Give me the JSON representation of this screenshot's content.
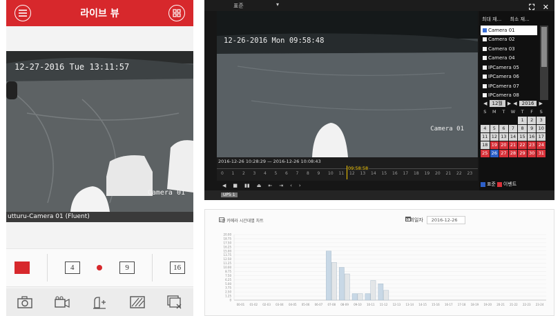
{
  "mobile_app": {
    "header": {
      "title": "라이브 뷰"
    },
    "video": {
      "timestamp": "12-27-2016 Tue 13:11:57",
      "camera_label": "Camera 01",
      "name_bar": "utturu-Camera 01 (Fluent)"
    },
    "layout_options": [
      "1",
      "4",
      "",
      "9",
      "16"
    ],
    "toolbar_icons": [
      "camera-icon",
      "video-record-icon",
      "ptz-icon",
      "image-quality-icon",
      "close-view-icon"
    ]
  },
  "nvr_playback": {
    "top_bar": {
      "standard_label": "표준",
      "arrow": "▾"
    },
    "window_controls": [
      "⛶",
      "✕"
    ],
    "video": {
      "timestamp": "12-26-2016 Mon 09:58:48",
      "camera_label": "Camera 01"
    },
    "tabs": [
      "최대 재...",
      "최소 재..."
    ],
    "cameras": [
      {
        "label": "Camera 01",
        "selected": true
      },
      {
        "label": "Camera 02",
        "selected": false
      },
      {
        "label": "Camera 03",
        "selected": false
      },
      {
        "label": "Camera 04",
        "selected": false
      },
      {
        "label": "IPCamera 05",
        "selected": false
      },
      {
        "label": "IPCamera 06",
        "selected": false
      },
      {
        "label": "IPCamera 07",
        "selected": false
      },
      {
        "label": "IPCamera 08",
        "selected": false
      }
    ],
    "calendar": {
      "month_label": "12월",
      "year_label": "2016",
      "weekdays": [
        "S",
        "M",
        "T",
        "W",
        "T",
        "F",
        "S"
      ],
      "start_offset": 4,
      "days": 31,
      "recorded_days": [
        19,
        20,
        21,
        22,
        23,
        24,
        25,
        26,
        27,
        28,
        29,
        30,
        31
      ],
      "today": 26
    },
    "timeline": {
      "range_text": "2016-12-26 10:28:29 — 2016-12-26 10:08:43",
      "current_marker": "09:58:58",
      "tick_labels": [
        "0",
        "1",
        "2",
        "3",
        "4",
        "5",
        "6",
        "7",
        "8",
        "9",
        "10",
        "11",
        "12",
        "13",
        "14",
        "15",
        "16",
        "17",
        "18",
        "19",
        "20",
        "21",
        "22",
        "23"
      ]
    },
    "controls": [
      "◀",
      "■",
      "▮▮",
      "⏏",
      "⇤",
      "⇥",
      "‹",
      "›"
    ],
    "legend": [
      {
        "label": "표준",
        "color": "#2d5fc7"
      },
      {
        "label": "이벤트",
        "color": "#d8323a"
      }
    ],
    "bottom_tag": "UP5 1"
  },
  "recording_chart": {
    "title": "1번 카메라 시간대별 차트",
    "date_label": "조회일자",
    "date_value": "2016-12-26",
    "chart_data": {
      "type": "bar",
      "categories": [
        "00-01",
        "01-02",
        "02-03",
        "03-04",
        "04-05",
        "05-06",
        "06-07",
        "07-08",
        "08-09",
        "09-10",
        "10-11",
        "11-12",
        "12-13",
        "13-14",
        "14-15",
        "15-16",
        "16-17",
        "17-18",
        "18-19",
        "19-20",
        "20-21",
        "21-22",
        "22-23",
        "23-24"
      ],
      "series": [
        {
          "values": [
            0,
            0,
            0,
            0,
            0,
            0,
            0,
            15.0,
            10.0,
            2.0,
            2.0,
            5.0,
            0,
            0,
            0,
            0,
            0,
            0,
            0,
            0,
            0,
            0,
            0,
            0
          ]
        },
        {
          "values": [
            0,
            0,
            0,
            0,
            0,
            0,
            0,
            11.5,
            8.0,
            2.0,
            6.0,
            3.0,
            0,
            0,
            0,
            0,
            0,
            0,
            0,
            0,
            0,
            0,
            0,
            0
          ]
        }
      ],
      "ylim": [
        0,
        20
      ],
      "y_ticks": [
        "20.00",
        "18.75",
        "17.50",
        "16.25",
        "15.00",
        "13.75",
        "12.50",
        "11.25",
        "10.00",
        "8.75",
        "7.50",
        "6.25",
        "5.00",
        "3.75",
        "2.50",
        "1.25",
        "0"
      ],
      "colors": [
        "#c8d8e6",
        "#e3e6e8"
      ],
      "grid": true
    }
  }
}
